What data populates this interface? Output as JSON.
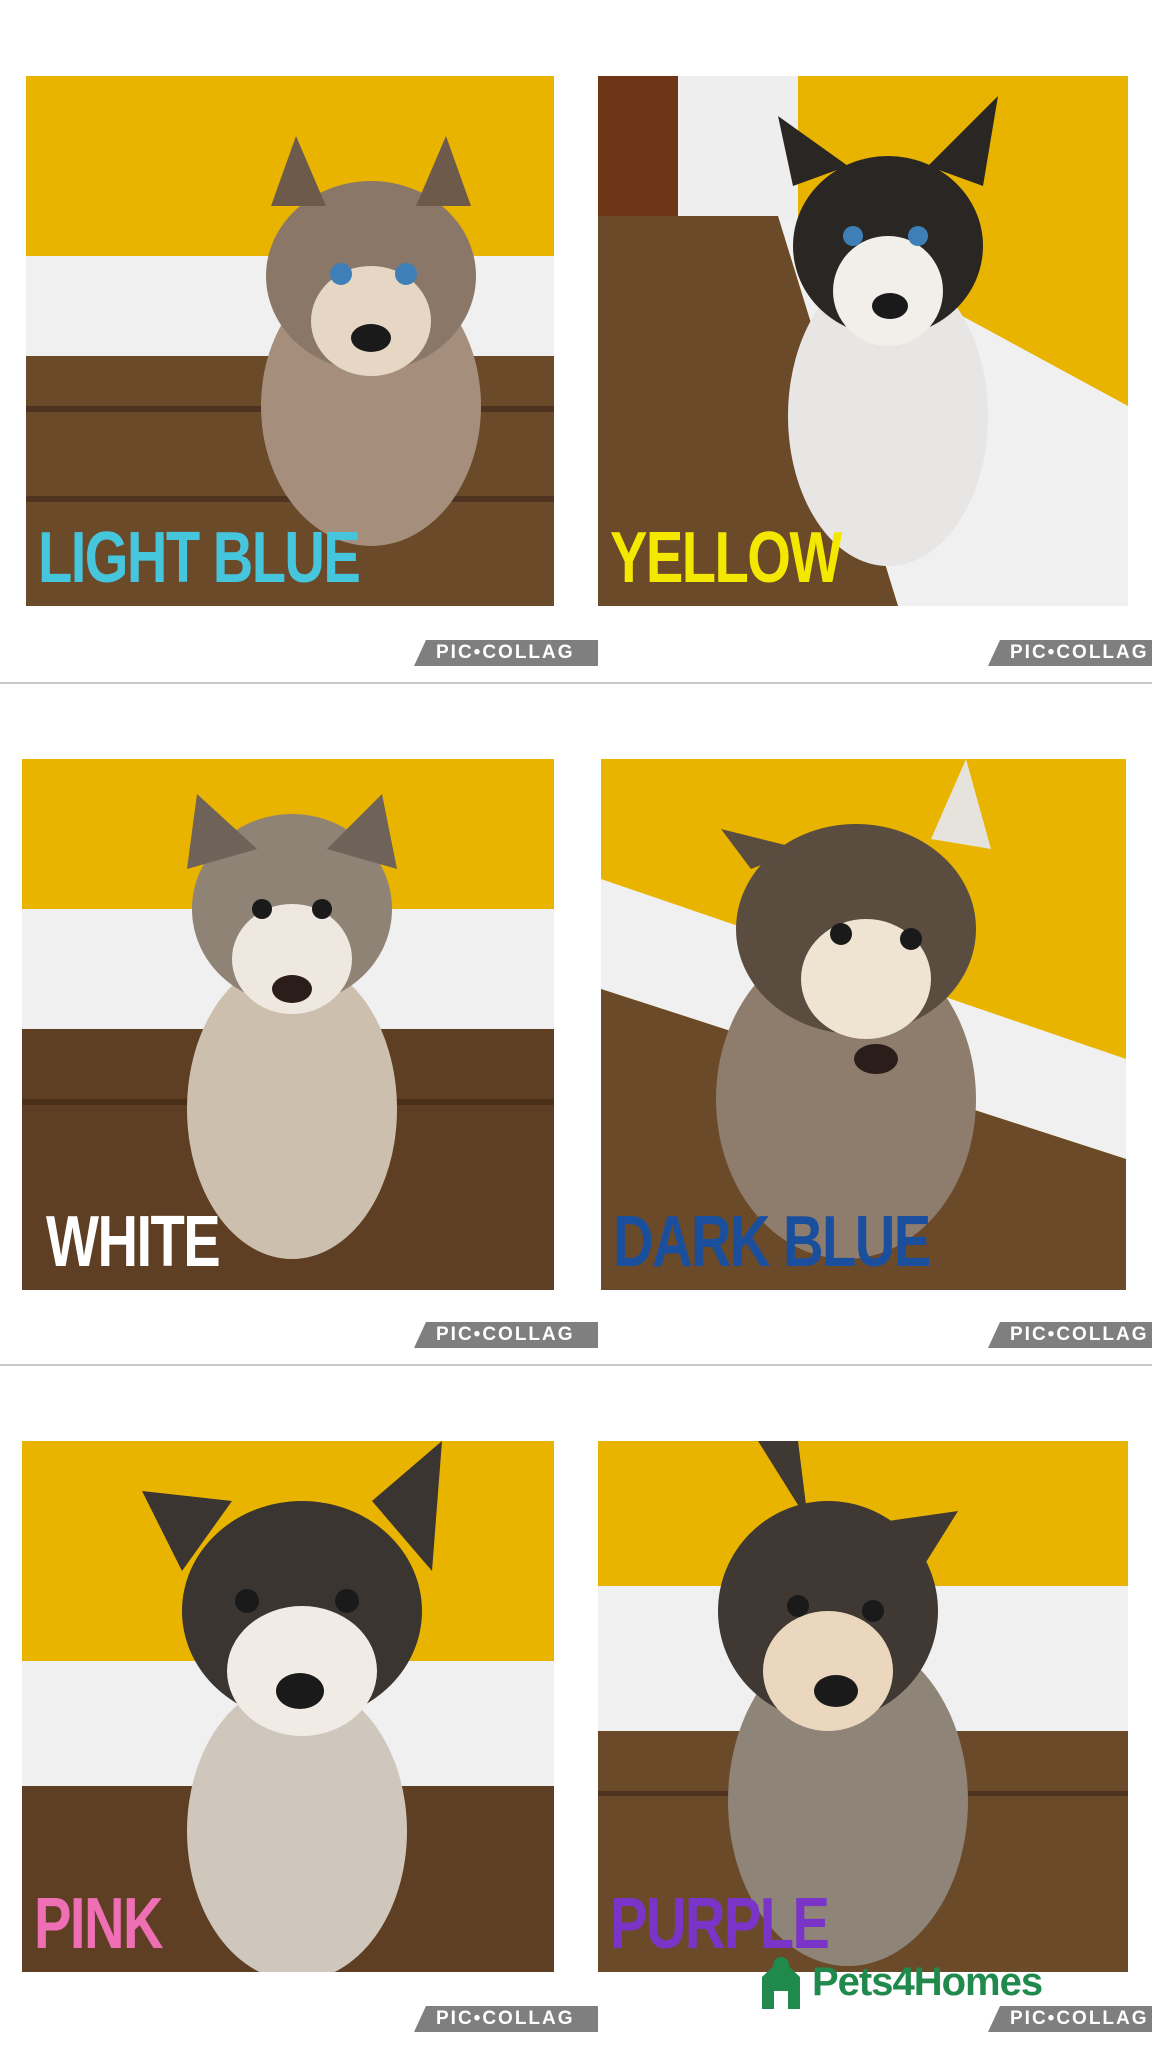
{
  "tiles": [
    {
      "label": "LIGHT BLUE",
      "label_color": "#46c6dd",
      "subject": "husky-puppy-blue-eyes"
    },
    {
      "label": "YELLOW",
      "label_color": "#f4e800",
      "subject": "husky-puppy-black-white"
    },
    {
      "label": "WHITE",
      "label_color": "#ffffff",
      "subject": "husky-puppy-grey-white"
    },
    {
      "label": "DARK BLUE",
      "label_color": "#1a4f9e",
      "subject": "husky-puppy-sable"
    },
    {
      "label": "PINK",
      "label_color": "#ef6fb4",
      "subject": "husky-puppy-black-grey"
    },
    {
      "label": "PURPLE",
      "label_color": "#7a35c8",
      "subject": "husky-puppy-black-tan"
    }
  ],
  "watermark_text": "PIC•COLLAG",
  "brand": {
    "name": "Pets4Homes",
    "color": "#1f8a4c"
  },
  "colors": {
    "wall": "#e8b400",
    "floor": "#6b4a2a",
    "skirting": "#f0f0f0"
  }
}
